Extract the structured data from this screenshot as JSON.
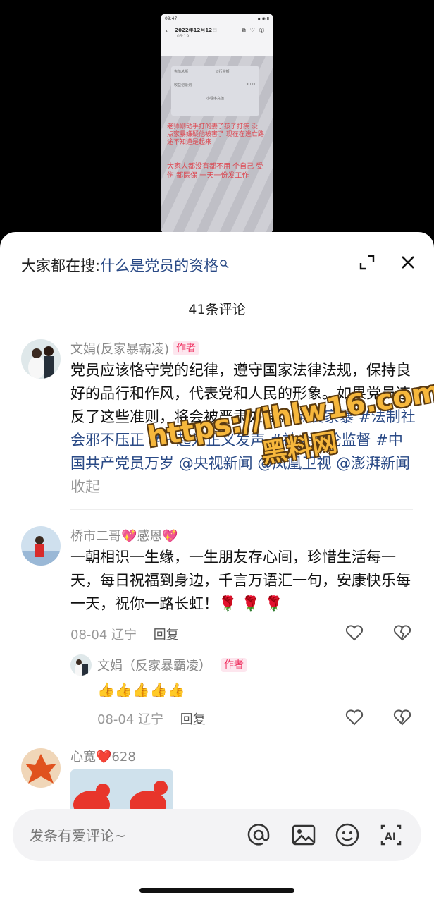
{
  "video": {
    "status_time": "09:47",
    "date": "2022年12月12日",
    "time": "05:19",
    "panel_col1": "充值总额",
    "panel_col2": "运行余额",
    "panel_row1": "收益记录列",
    "panel_amount": "¥0.00",
    "panel_note": "小程序充值",
    "overlay_text_1": "老师刚动手打的妻子孩子打疾 没一点家暴嫌疑他被害了 现在在逃亡路途不知道是起来",
    "overlay_text_2": "大家人都没有都不用 个自己 受伤 都医保 一天一份发工作"
  },
  "header": {
    "search_prefix": "大家都在搜:",
    "search_query": "什么是党员的资格",
    "comment_count": "41条评论"
  },
  "comments": [
    {
      "user": "文娟(反家暴霸凌)",
      "badge": "作者",
      "text_plain": "党员应该恪守党的纪律，遵守国家法律法规，保持良好的品行和作风，代表党和人民的形象。如果党员违反了这些准则，将会被严肃处理。",
      "tags": [
        "#反家暴",
        "#法制社会邪不压正",
        "#一起为正义发声",
        "#社会舆论监督",
        "#中国共产党员万岁",
        "@央视新闻",
        "@凤凰卫视",
        "@澎湃新闻"
      ],
      "fold": "收起"
    },
    {
      "user": "桥市二哥💖感恩💖",
      "text": "一朝相识一生缘，一生朋友存心间，珍惜生活每一天，每日祝福到身边，千言万语汇一句，安康快乐每一天，祝你一路长虹！🌹 🌹 🌹",
      "date": "08-04",
      "location": "辽宁",
      "reply": "回复",
      "sub_reply": {
        "user": "文娟（反家暴霸凌）",
        "badge": "作者",
        "text": "👍👍👍👍👍",
        "date": "08-04",
        "location": "辽宁",
        "reply": "回复"
      }
    },
    {
      "user": "心宽❤️628"
    }
  ],
  "input": {
    "placeholder": "发条有爱评论~"
  },
  "watermark": {
    "line1": "https://ihlw16.com",
    "line2": "黑料网"
  }
}
